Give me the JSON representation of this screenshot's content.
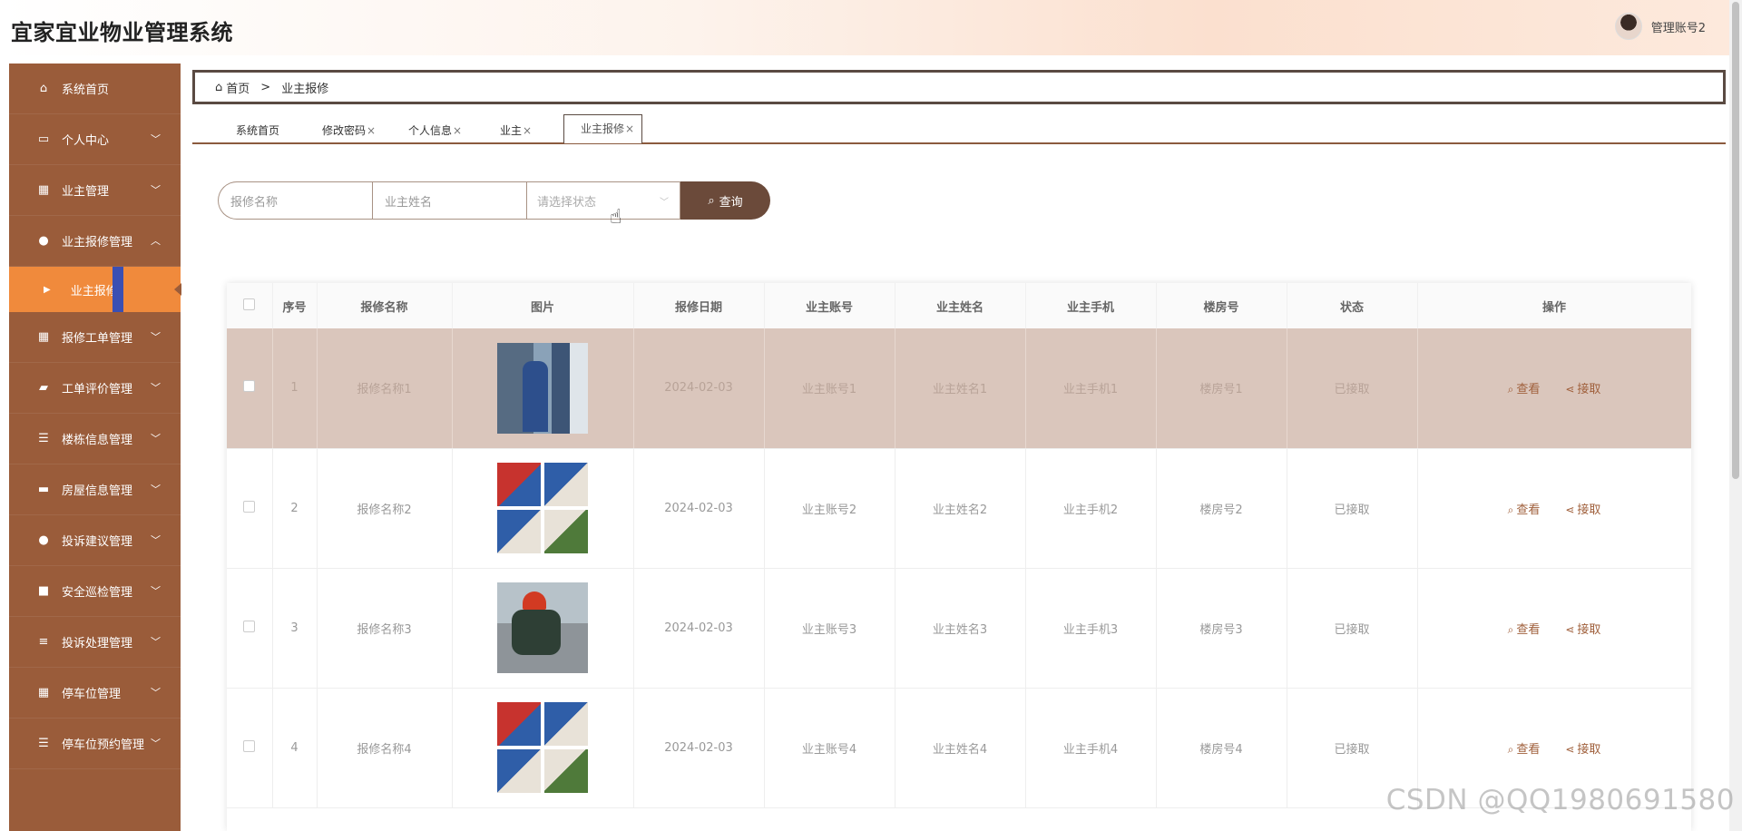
{
  "app": {
    "title": "宜家宜业物业管理系统",
    "username": "管理账号2"
  },
  "sidebar": {
    "items": [
      {
        "label": "系统首页",
        "icon": "home-icon",
        "glyph": "⌂",
        "has_chevron": false
      },
      {
        "label": "个人中心",
        "icon": "calendar-icon",
        "glyph": "▭",
        "has_chevron": true,
        "chevron": "﹀"
      },
      {
        "label": "业主管理",
        "icon": "grid-icon",
        "glyph": "▦",
        "has_chevron": true,
        "chevron": "﹀"
      },
      {
        "label": "业主报修管理",
        "icon": "user-icon",
        "glyph": "●",
        "has_chevron": true,
        "chevron": "︿"
      },
      {
        "label": "报修工单管理",
        "icon": "grid-icon",
        "glyph": "▦",
        "has_chevron": true,
        "chevron": "﹀"
      },
      {
        "label": "工单评价管理",
        "icon": "folder-icon",
        "glyph": "▰",
        "has_chevron": true,
        "chevron": "﹀"
      },
      {
        "label": "楼栋信息管理",
        "icon": "list-icon",
        "glyph": "☰",
        "has_chevron": true,
        "chevron": "﹀"
      },
      {
        "label": "房屋信息管理",
        "icon": "ticket-icon",
        "glyph": "▬",
        "has_chevron": true,
        "chevron": "﹀"
      },
      {
        "label": "投诉建议管理",
        "icon": "user-icon",
        "glyph": "●",
        "has_chevron": true,
        "chevron": "﹀"
      },
      {
        "label": "安全巡检管理",
        "icon": "monitor-icon",
        "glyph": "■",
        "has_chevron": true,
        "chevron": "﹀"
      },
      {
        "label": "投诉处理管理",
        "icon": "sliders-icon",
        "glyph": "≡",
        "has_chevron": true,
        "chevron": "﹀"
      },
      {
        "label": "停车位管理",
        "icon": "grid-icon",
        "glyph": "▦",
        "has_chevron": true,
        "chevron": "﹀"
      },
      {
        "label": "停车位预约管理",
        "icon": "list-icon",
        "glyph": "☰",
        "has_chevron": true,
        "chevron": "﹀"
      }
    ],
    "active_sub": {
      "label": "业主报修",
      "arrow": "▶"
    }
  },
  "breadcrumb": {
    "home": "首页",
    "separator": ">",
    "current": "业主报修",
    "home_glyph": "⌂"
  },
  "tabs": [
    {
      "label": "系统首页",
      "closable": false
    },
    {
      "label": "修改密码",
      "closable": true
    },
    {
      "label": "个人信息",
      "closable": true
    },
    {
      "label": "业主",
      "closable": true
    },
    {
      "label": "业主报修",
      "closable": true,
      "active": true
    }
  ],
  "tab_close": "×",
  "search": {
    "name_placeholder": "报修名称",
    "owner_placeholder": "业主姓名",
    "status_placeholder": "请选择状态",
    "select_chevron": "﹀",
    "button_label": "查询",
    "button_glyph": "⌕"
  },
  "table": {
    "headers": [
      "序号",
      "报修名称",
      "图片",
      "报修日期",
      "业主账号",
      "业主姓名",
      "业主手机",
      "楼房号",
      "状态",
      "操作"
    ],
    "rows": [
      {
        "no": "1",
        "name": "报修名称1",
        "image": "t1",
        "date": "2024-02-03",
        "account": "业主账号1",
        "owner": "业主姓名1",
        "phone": "业主手机1",
        "room": "楼房号1",
        "status": "已接取"
      },
      {
        "no": "2",
        "name": "报修名称2",
        "image": "t2",
        "date": "2024-02-03",
        "account": "业主账号2",
        "owner": "业主姓名2",
        "phone": "业主手机2",
        "room": "楼房号2",
        "status": "已接取"
      },
      {
        "no": "3",
        "name": "报修名称3",
        "image": "t3",
        "date": "2024-02-03",
        "account": "业主账号3",
        "owner": "业主姓名3",
        "phone": "业主手机3",
        "room": "楼房号3",
        "status": "已接取"
      },
      {
        "no": "4",
        "name": "报修名称4",
        "image": "t2",
        "date": "2024-02-03",
        "account": "业主账号4",
        "owner": "业主姓名4",
        "phone": "业主手机4",
        "room": "楼房号4",
        "status": "已接取"
      }
    ],
    "actions": {
      "view": "查看",
      "view_glyph": "⌕",
      "accept": "接取",
      "accept_glyph": "⋖"
    }
  },
  "watermark": "CSDN @QQ1980691580",
  "cursor_glyph": "☝",
  "colors": {
    "sidebar": "#9a5c3a",
    "active_menu": "#f08a3c",
    "accent_bar": "#3a4fb3",
    "search_button": "#6b4a3a",
    "highlight_row": "#dac6bc",
    "action_text": "#a0603c"
  }
}
